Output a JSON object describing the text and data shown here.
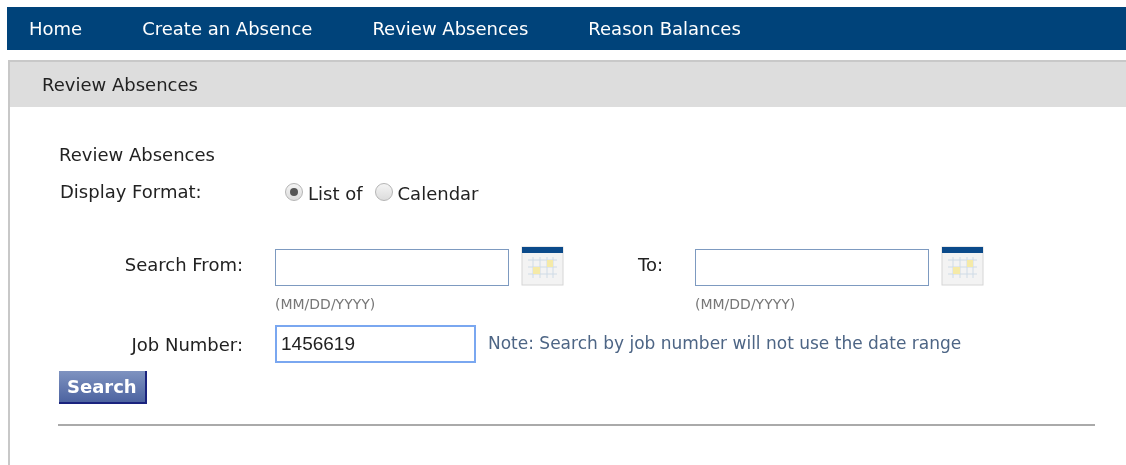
{
  "nav": {
    "items": [
      {
        "label": "Home"
      },
      {
        "label": "Create an Absence"
      },
      {
        "label": "Review Absences"
      },
      {
        "label": "Reason Balances"
      }
    ]
  },
  "panel": {
    "title": "Review Absences"
  },
  "section_title": "Review Absences",
  "display_format": {
    "label": "Display Format:",
    "options": [
      {
        "label": "List of",
        "selected": true
      },
      {
        "label": "Calendar",
        "selected": false
      }
    ]
  },
  "date_fields": [
    {
      "label": "Search From:",
      "hint": "(MM/DD/YYYY)"
    },
    {
      "label": "To:",
      "hint": "(MM/DD/YYYY)"
    }
  ],
  "job_number": {
    "label": "Job Number:",
    "value": "1456619",
    "focused": true
  },
  "note": "Note: Search by job number will not use the date range",
  "search_button": "Search"
}
